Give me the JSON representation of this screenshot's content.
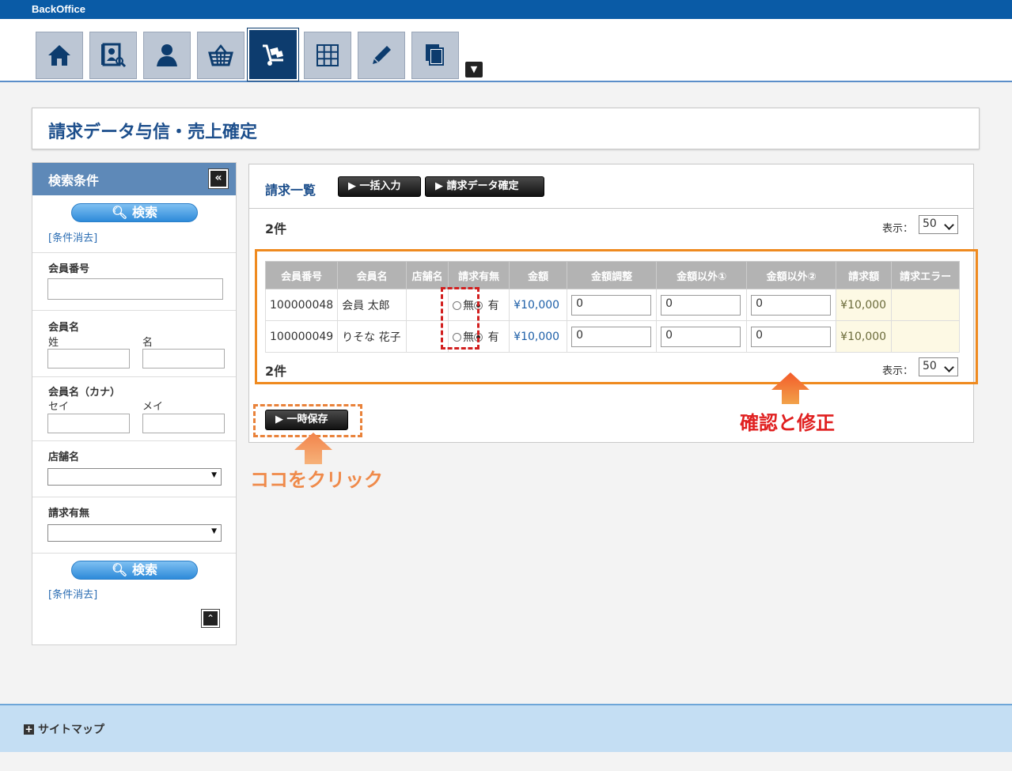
{
  "app": {
    "brand": "BackOffice"
  },
  "nav": {
    "items": [
      {
        "icon": "home-icon"
      },
      {
        "icon": "member-search-icon"
      },
      {
        "icon": "user-icon"
      },
      {
        "icon": "basket-icon"
      },
      {
        "icon": "cart-icon",
        "active": true
      },
      {
        "icon": "grid-icon"
      },
      {
        "icon": "pencil-icon"
      },
      {
        "icon": "documents-icon"
      }
    ],
    "more_glyph": "▼"
  },
  "page": {
    "title": "請求データ与信・売上確定"
  },
  "sidebar": {
    "title": "検索条件",
    "collapse_glyph": "«",
    "search_label": "検索",
    "clear_label": "[条件消去]",
    "fields": {
      "member_no": "会員番号",
      "member_name": "会員名",
      "last_name": "姓",
      "first_name": "名",
      "member_kana": "会員名（カナ）",
      "last_kana": "セイ",
      "first_kana": "メイ",
      "store_name": "店舗名",
      "billing": "請求有無"
    },
    "totop_glyph": "⌃"
  },
  "list": {
    "title": "請求一覧",
    "bulk_button": "一括入力",
    "confirm_button": "請求データ確定",
    "count": "2件",
    "display_label": "表示：",
    "display_value": "50",
    "columns": [
      "会員番号",
      "会員名",
      "店舗名",
      "請求有無",
      "金額",
      "金額調整",
      "金額以外①",
      "金額以外②",
      "請求額",
      "請求エラー"
    ],
    "radio_no": "無",
    "radio_yes": "有",
    "rows": [
      {
        "member_no": "100000048",
        "name": "会員 太郎",
        "store": "",
        "amount": "¥10,000",
        "adjust": "0",
        "other1": "0",
        "other2": "0",
        "bill": "¥10,000",
        "error": ""
      },
      {
        "member_no": "100000049",
        "name": "りそな 花子",
        "store": "",
        "amount": "¥10,000",
        "adjust": "0",
        "other1": "0",
        "other2": "0",
        "bill": "¥10,000",
        "error": ""
      }
    ],
    "save_button": "一時保存"
  },
  "annotations": {
    "confirm_fix": "確認と修正",
    "click_here": "ココをクリック"
  },
  "footer": {
    "sitemap": "サイトマップ"
  }
}
